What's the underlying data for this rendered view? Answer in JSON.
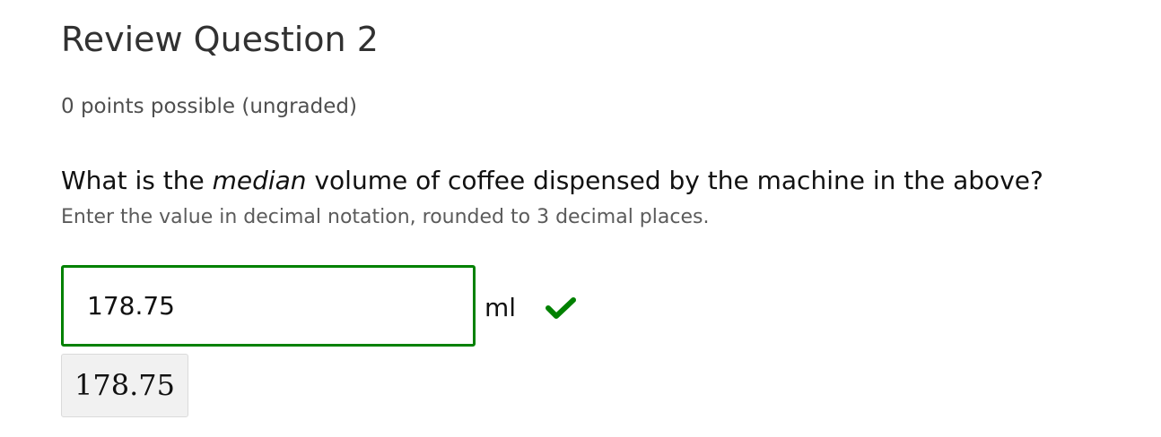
{
  "problem": {
    "title": "Review Question 2",
    "points": "0 points possible (ungraded)",
    "question_before": "What is the ",
    "question_emphasis": "median",
    "question_after": " volume of coffee dispensed by the machine in the above?",
    "hint": "Enter the value in decimal notation, rounded to 3 decimal places."
  },
  "answer": {
    "value": "178.75",
    "unit": "ml",
    "status": "correct",
    "status_icon": "check-icon",
    "preview": "178.75"
  },
  "colors": {
    "correct": "#008100",
    "preview_bg": "#f1f1f1"
  }
}
